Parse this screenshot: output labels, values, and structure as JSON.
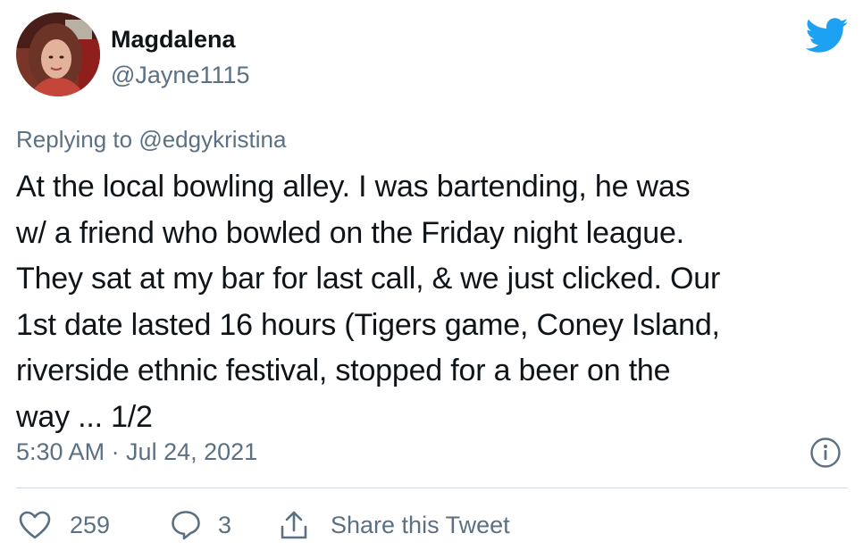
{
  "user": {
    "display_name": "Magdalena",
    "handle": "@Jayne1115"
  },
  "reply_context": {
    "prefix": "Replying to",
    "mention": "@edgykristina"
  },
  "tweet_lines": [
    "At the local bowling alley.  I was bartending, he was",
    "w/ a friend who bowled on the Friday night league.",
    "They sat at my bar for last call, & we just clicked.  Our",
    "1st date lasted 16 hours (Tigers game, Coney Island,",
    "riverside ethnic festival, stopped for a beer on the",
    "way ... 1/2"
  ],
  "timestamp": "5:30 AM · Jul 24, 2021",
  "actions": {
    "likes_count": "259",
    "replies_count": "3",
    "share_label": "Share this Tweet"
  },
  "colors": {
    "text_primary": "#0f1419",
    "text_secondary": "#5b7083",
    "twitter_blue": "#1da1f2",
    "divider": "#cfd9de"
  },
  "icons": {
    "brand": "twitter-bird-icon",
    "info": "info-icon",
    "like": "heart-icon",
    "reply": "speech-bubble-icon",
    "share": "share-icon"
  }
}
